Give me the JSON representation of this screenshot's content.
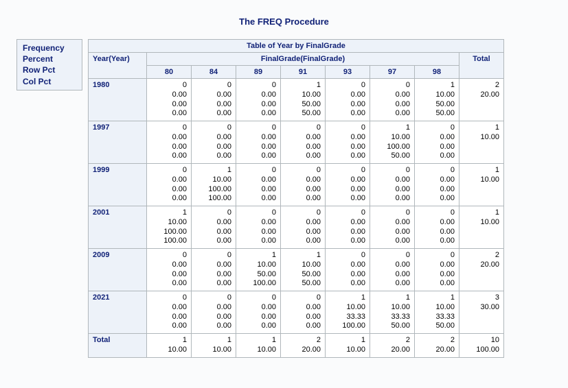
{
  "title": "The FREQ Procedure",
  "legend": [
    "Frequency",
    "Percent",
    "Row Pct",
    "Col Pct"
  ],
  "table_title": "Table of Year by FinalGrade",
  "col_var_label": "FinalGrade(FinalGrade)",
  "row_var_label": "Year(Year)",
  "total_label": "Total",
  "columns": [
    "80",
    "84",
    "89",
    "91",
    "93",
    "97",
    "98"
  ],
  "rows": [
    {
      "label": "1980",
      "cells": [
        [
          "0",
          "0.00",
          "0.00",
          "0.00"
        ],
        [
          "0",
          "0.00",
          "0.00",
          "0.00"
        ],
        [
          "0",
          "0.00",
          "0.00",
          "0.00"
        ],
        [
          "1",
          "10.00",
          "50.00",
          "50.00"
        ],
        [
          "0",
          "0.00",
          "0.00",
          "0.00"
        ],
        [
          "0",
          "0.00",
          "0.00",
          "0.00"
        ],
        [
          "1",
          "10.00",
          "50.00",
          "50.00"
        ]
      ],
      "total": [
        "2",
        "20.00"
      ]
    },
    {
      "label": "1997",
      "cells": [
        [
          "0",
          "0.00",
          "0.00",
          "0.00"
        ],
        [
          "0",
          "0.00",
          "0.00",
          "0.00"
        ],
        [
          "0",
          "0.00",
          "0.00",
          "0.00"
        ],
        [
          "0",
          "0.00",
          "0.00",
          "0.00"
        ],
        [
          "0",
          "0.00",
          "0.00",
          "0.00"
        ],
        [
          "1",
          "10.00",
          "100.00",
          "50.00"
        ],
        [
          "0",
          "0.00",
          "0.00",
          "0.00"
        ]
      ],
      "total": [
        "1",
        "10.00"
      ]
    },
    {
      "label": "1999",
      "cells": [
        [
          "0",
          "0.00",
          "0.00",
          "0.00"
        ],
        [
          "1",
          "10.00",
          "100.00",
          "100.00"
        ],
        [
          "0",
          "0.00",
          "0.00",
          "0.00"
        ],
        [
          "0",
          "0.00",
          "0.00",
          "0.00"
        ],
        [
          "0",
          "0.00",
          "0.00",
          "0.00"
        ],
        [
          "0",
          "0.00",
          "0.00",
          "0.00"
        ],
        [
          "0",
          "0.00",
          "0.00",
          "0.00"
        ]
      ],
      "total": [
        "1",
        "10.00"
      ]
    },
    {
      "label": "2001",
      "cells": [
        [
          "1",
          "10.00",
          "100.00",
          "100.00"
        ],
        [
          "0",
          "0.00",
          "0.00",
          "0.00"
        ],
        [
          "0",
          "0.00",
          "0.00",
          "0.00"
        ],
        [
          "0",
          "0.00",
          "0.00",
          "0.00"
        ],
        [
          "0",
          "0.00",
          "0.00",
          "0.00"
        ],
        [
          "0",
          "0.00",
          "0.00",
          "0.00"
        ],
        [
          "0",
          "0.00",
          "0.00",
          "0.00"
        ]
      ],
      "total": [
        "1",
        "10.00"
      ]
    },
    {
      "label": "2009",
      "cells": [
        [
          "0",
          "0.00",
          "0.00",
          "0.00"
        ],
        [
          "0",
          "0.00",
          "0.00",
          "0.00"
        ],
        [
          "1",
          "10.00",
          "50.00",
          "100.00"
        ],
        [
          "1",
          "10.00",
          "50.00",
          "50.00"
        ],
        [
          "0",
          "0.00",
          "0.00",
          "0.00"
        ],
        [
          "0",
          "0.00",
          "0.00",
          "0.00"
        ],
        [
          "0",
          "0.00",
          "0.00",
          "0.00"
        ]
      ],
      "total": [
        "2",
        "20.00"
      ]
    },
    {
      "label": "2021",
      "cells": [
        [
          "0",
          "0.00",
          "0.00",
          "0.00"
        ],
        [
          "0",
          "0.00",
          "0.00",
          "0.00"
        ],
        [
          "0",
          "0.00",
          "0.00",
          "0.00"
        ],
        [
          "0",
          "0.00",
          "0.00",
          "0.00"
        ],
        [
          "1",
          "10.00",
          "33.33",
          "100.00"
        ],
        [
          "1",
          "10.00",
          "33.33",
          "50.00"
        ],
        [
          "1",
          "10.00",
          "33.33",
          "50.00"
        ]
      ],
      "total": [
        "3",
        "30.00"
      ]
    }
  ],
  "col_totals": {
    "cells": [
      [
        "1",
        "10.00"
      ],
      [
        "1",
        "10.00"
      ],
      [
        "1",
        "10.00"
      ],
      [
        "2",
        "20.00"
      ],
      [
        "1",
        "10.00"
      ],
      [
        "2",
        "20.00"
      ],
      [
        "2",
        "20.00"
      ]
    ],
    "grand": [
      "10",
      "100.00"
    ]
  }
}
